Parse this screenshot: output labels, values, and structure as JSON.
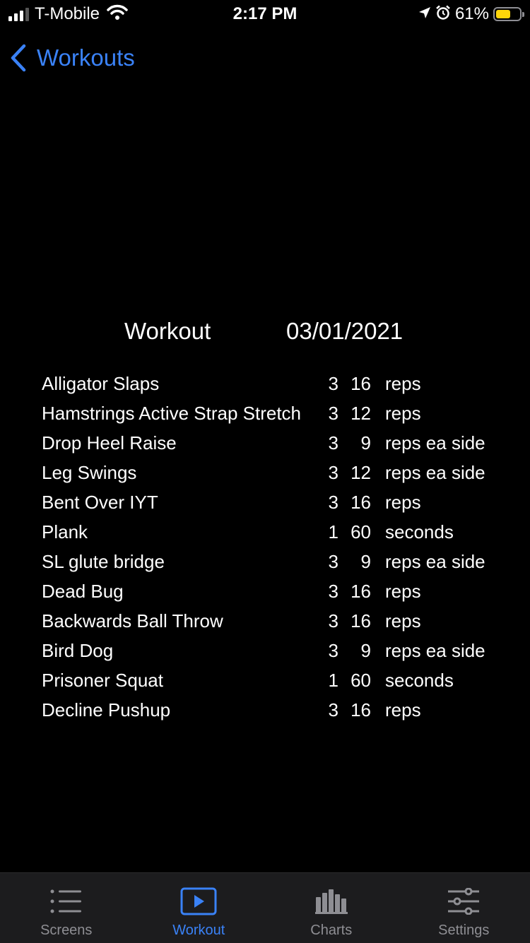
{
  "status_bar": {
    "carrier": "T-Mobile",
    "time": "2:17 PM",
    "battery_percent": "61%",
    "battery_level": 0.61,
    "icons": [
      "signal-icon",
      "wifi-icon",
      "location-arrow-icon",
      "alarm-icon",
      "battery-icon"
    ]
  },
  "nav": {
    "back_label": "Workouts"
  },
  "workout": {
    "title": "Workout",
    "date": "03/01/2021",
    "exercises": [
      {
        "name": "Alligator Slaps",
        "sets": "3",
        "reps": "16",
        "unit": "reps"
      },
      {
        "name": "Hamstrings Active Strap Stretch",
        "sets": "3",
        "reps": "12",
        "unit": "reps"
      },
      {
        "name": "Drop Heel Raise",
        "sets": "3",
        "reps": "9",
        "unit": "reps ea side"
      },
      {
        "name": "Leg Swings",
        "sets": "3",
        "reps": "12",
        "unit": "reps ea side"
      },
      {
        "name": "Bent Over IYT",
        "sets": "3",
        "reps": "16",
        "unit": "reps"
      },
      {
        "name": "Plank",
        "sets": "1",
        "reps": "60",
        "unit": "seconds"
      },
      {
        "name": "SL glute bridge",
        "sets": "3",
        "reps": "9",
        "unit": "reps ea side"
      },
      {
        "name": "Dead Bug",
        "sets": "3",
        "reps": "16",
        "unit": "reps"
      },
      {
        "name": "Backwards Ball Throw",
        "sets": "3",
        "reps": "16",
        "unit": "reps"
      },
      {
        "name": "Bird Dog",
        "sets": "3",
        "reps": "9",
        "unit": "reps ea side"
      },
      {
        "name": "Prisoner Squat",
        "sets": "1",
        "reps": "60",
        "unit": "seconds"
      },
      {
        "name": "Decline Pushup",
        "sets": "3",
        "reps": "16",
        "unit": "reps"
      }
    ]
  },
  "tab_bar": {
    "tabs": [
      {
        "label": "Screens",
        "icon": "list-icon"
      },
      {
        "label": "Workout",
        "icon": "play-icon",
        "active": true
      },
      {
        "label": "Charts",
        "icon": "bar-chart-icon"
      },
      {
        "label": "Settings",
        "icon": "sliders-icon"
      }
    ]
  },
  "colors": {
    "accent": "#3a82f7",
    "background": "#000000",
    "tab_bar": "#1c1c1e",
    "inactive": "#8e8e93",
    "battery": "#ffd60a"
  }
}
